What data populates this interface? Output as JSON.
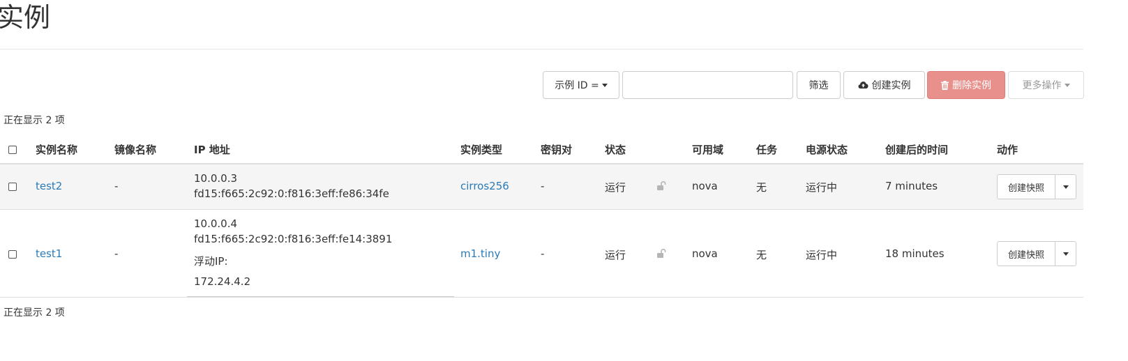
{
  "page": {
    "title": "实例"
  },
  "toolbar": {
    "filter_select_label": "示例 ID =",
    "filter_input_value": "",
    "filter_button": "筛选",
    "create_button": "创建实例",
    "delete_button": "删除实例",
    "more_button": "更多操作"
  },
  "count_text_top": "正在显示 2 项",
  "count_text_bottom": "正在显示 2 项",
  "table": {
    "headers": {
      "name": "实例名称",
      "image": "镜像名称",
      "ip": "IP 地址",
      "flavor": "实例类型",
      "keypair": "密钥对",
      "status": "状态",
      "zone": "可用域",
      "task": "任务",
      "power": "电源状态",
      "age": "创建后的时间",
      "actions": "动作"
    },
    "rows": [
      {
        "name": "test2",
        "image": "-",
        "ip_lines": [
          "10.0.0.3",
          "fd15:f665:2c92:0:f816:3eff:fe86:34fe"
        ],
        "flavor": "cirros256",
        "keypair": "-",
        "status": "运行",
        "zone": "nova",
        "task": "无",
        "power": "运行中",
        "age": "7 minutes",
        "action": "创建快照"
      },
      {
        "name": "test1",
        "image": "-",
        "ip_lines": [
          "10.0.0.4",
          "fd15:f665:2c92:0:f816:3eff:fe14:3891",
          "浮动IP:",
          "172.24.4.2"
        ],
        "flavor": "m1.tiny",
        "keypair": "-",
        "status": "运行",
        "zone": "nova",
        "task": "无",
        "power": "运行中",
        "age": "18 minutes",
        "action": "创建快照"
      }
    ]
  },
  "icons": {
    "create": "cloud-upload-icon",
    "delete": "trash-icon",
    "lock": "unlock-icon",
    "caret": "caret-down-icon"
  },
  "colors": {
    "link": "#2a7ab8",
    "danger": "#e8918c",
    "row_alt": "#f5f5f5"
  }
}
